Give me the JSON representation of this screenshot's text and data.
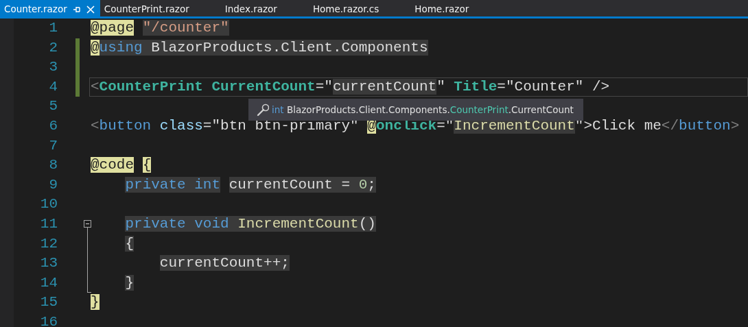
{
  "tabs": [
    {
      "label": "Counter.razor",
      "selected": true,
      "pinnable": true,
      "closable": true
    },
    {
      "label": "CounterPrint.razor",
      "selected": false,
      "pinnable": false,
      "closable": false
    },
    {
      "label": "Index.razor",
      "selected": false,
      "pinnable": false,
      "closable": false
    },
    {
      "label": "Home.razor.cs",
      "selected": false,
      "pinnable": false,
      "closable": false
    },
    {
      "label": "Home.razor",
      "selected": false,
      "pinnable": false,
      "closable": false
    }
  ],
  "editor": {
    "lines": [
      {
        "number": "1",
        "changed": false,
        "current": false,
        "tokens": [
          {
            "text": "@page",
            "kind": "razor",
            "shaded": false
          },
          {
            "text": " \"/counter\"",
            "kind": "string",
            "shaded": true
          }
        ]
      },
      {
        "number": "2",
        "changed": true,
        "current": false,
        "tokens": [
          {
            "text": "@",
            "kind": "razor",
            "shaded": false
          },
          {
            "text": "using ",
            "kind": "keyword",
            "shaded": true
          },
          {
            "text": "BlazorProducts.Client.Components",
            "kind": "text",
            "shaded": true
          }
        ]
      },
      {
        "number": "3",
        "changed": true,
        "current": false
      },
      {
        "number": "4",
        "changed": true,
        "current": true,
        "tokens": [
          {
            "text": "<",
            "kind": "punct",
            "shaded": false
          },
          {
            "text": "CounterPrint ",
            "kind": "component",
            "shaded": false
          },
          {
            "text": "CurrentCount",
            "kind": "component",
            "shaded": false
          },
          {
            "text": "=\"",
            "kind": "text",
            "shaded": false
          },
          {
            "text": "currentCount",
            "kind": "text",
            "shaded": true
          },
          {
            "text": "\" ",
            "kind": "text",
            "shaded": false
          },
          {
            "text": "Title",
            "kind": "component",
            "shaded": false
          },
          {
            "text": "=\"Counter\" />",
            "kind": "text",
            "shaded": false
          }
        ]
      },
      {
        "number": "5",
        "changed": false,
        "current": false
      },
      {
        "number": "6",
        "changed": false,
        "current": false,
        "tokens": [
          {
            "text": "<",
            "kind": "punct",
            "shaded": false
          },
          {
            "text": "button",
            "kind": "element",
            "shaded": false
          },
          {
            "text": " class",
            "kind": "attribute",
            "shaded": false
          },
          {
            "text": "=\"btn btn-primary\" ",
            "kind": "text",
            "shaded": false
          },
          {
            "text": "@",
            "kind": "razor",
            "shaded": false
          },
          {
            "text": "onclick",
            "kind": "component",
            "shaded": false
          },
          {
            "text": "=\"",
            "kind": "text",
            "shaded": false
          },
          {
            "text": "IncrementCount",
            "kind": "method",
            "shaded": true
          },
          {
            "text": "\">",
            "kind": "text",
            "shaded": false
          },
          {
            "text": "Click me",
            "kind": "text",
            "shaded": false
          },
          {
            "text": "</",
            "kind": "punct",
            "shaded": false
          },
          {
            "text": "button",
            "kind": "element",
            "shaded": false
          },
          {
            "text": ">",
            "kind": "punct",
            "shaded": false
          }
        ]
      },
      {
        "number": "7",
        "changed": false,
        "current": false
      },
      {
        "number": "8",
        "changed": false,
        "current": false,
        "tokens": [
          {
            "text": "@code",
            "kind": "razor",
            "shaded": false
          },
          {
            "text": " {",
            "kind": "razor",
            "shaded": false
          }
        ]
      },
      {
        "number": "9",
        "changed": false,
        "current": false,
        "tokens": [
          {
            "text": "    private int",
            "kind": "keyword",
            "shaded": true
          },
          {
            "text": " currentCount = ",
            "kind": "text",
            "shaded": true
          },
          {
            "text": "0",
            "kind": "number",
            "shaded": true
          },
          {
            "text": ";",
            "kind": "text",
            "shaded": true
          }
        ]
      },
      {
        "number": "10",
        "changed": false,
        "current": false
      },
      {
        "number": "11",
        "changed": false,
        "current": false,
        "foldable": true,
        "tokens": [
          {
            "text": "    private void ",
            "kind": "keyword",
            "shaded": true
          },
          {
            "text": "IncrementCount",
            "kind": "method",
            "shaded": true
          },
          {
            "text": "()",
            "kind": "text",
            "shaded": true
          }
        ]
      },
      {
        "number": "12",
        "changed": false,
        "current": false,
        "in_fold": true,
        "tokens": [
          {
            "text": "    {",
            "kind": "text",
            "shaded": true
          }
        ]
      },
      {
        "number": "13",
        "changed": false,
        "current": false,
        "in_fold": true,
        "tokens": [
          {
            "text": "        currentCount++;",
            "kind": "text",
            "shaded": true
          }
        ]
      },
      {
        "number": "14",
        "changed": false,
        "current": false,
        "in_fold": true,
        "tokens": [
          {
            "text": "    }",
            "kind": "text",
            "shaded": true
          }
        ]
      },
      {
        "number": "15",
        "changed": false,
        "current": false,
        "tokens": [
          {
            "text": "}",
            "kind": "razor",
            "shaded": false
          }
        ]
      },
      {
        "number": "16",
        "changed": false,
        "current": false
      }
    ],
    "tooltip": {
      "tokens": [
        {
          "text": "int",
          "kind": "keyword"
        },
        {
          "text": " BlazorProducts.Client.Components.",
          "kind": "text"
        },
        {
          "text": "CounterPrint",
          "kind": "component"
        },
        {
          "text": ".CurrentCount",
          "kind": "text"
        }
      ]
    }
  }
}
